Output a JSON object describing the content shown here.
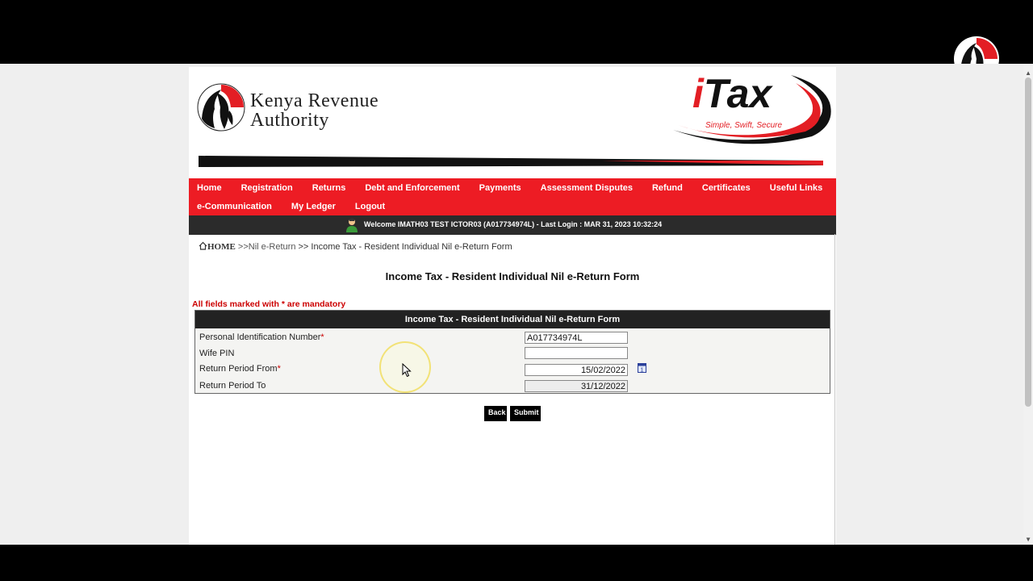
{
  "kra": {
    "line1": "Kenya Revenue",
    "line2": "Authority"
  },
  "itax": {
    "word_i": "i",
    "word_tax": "Tax",
    "slogan": "Simple, Swift, Secure"
  },
  "nav": {
    "row1": [
      "Home",
      "Registration",
      "Returns",
      "Debt and Enforcement",
      "Payments",
      "Assessment Disputes",
      "Refund",
      "Certificates",
      "Useful Links"
    ],
    "row2": [
      "e-Communication",
      "My Ledger",
      "Logout"
    ]
  },
  "welcome": "Welcome IMATH03 TEST ICTOR03 (A017734974L)  - Last Login : MAR 31, 2023 10:32:24",
  "breadcrumb": {
    "home": "HOME",
    "link": " >>Nil e-Return",
    "current": " >> Income Tax - Resident Individual Nil e-Return Form"
  },
  "page_title": "Income Tax - Resident Individual Nil e-Return Form",
  "mandatory_note": "All fields marked with * are mandatory",
  "form": {
    "header": "Income Tax - Resident Individual Nil e-Return Form",
    "pin_label": "Personal Identification Number",
    "pin_value": "A017734974L",
    "wife_pin_label": "Wife PIN",
    "wife_pin_value": "",
    "from_label": "Return Period From",
    "from_value": "15/02/2022",
    "to_label": "Return Period To",
    "to_value": "31/12/2022",
    "required_mark": "*"
  },
  "buttons": {
    "back": "Back",
    "submit": "Submit"
  },
  "colors": {
    "nav_red": "#ed1c24",
    "welcome_bar": "#2b2b2b"
  }
}
